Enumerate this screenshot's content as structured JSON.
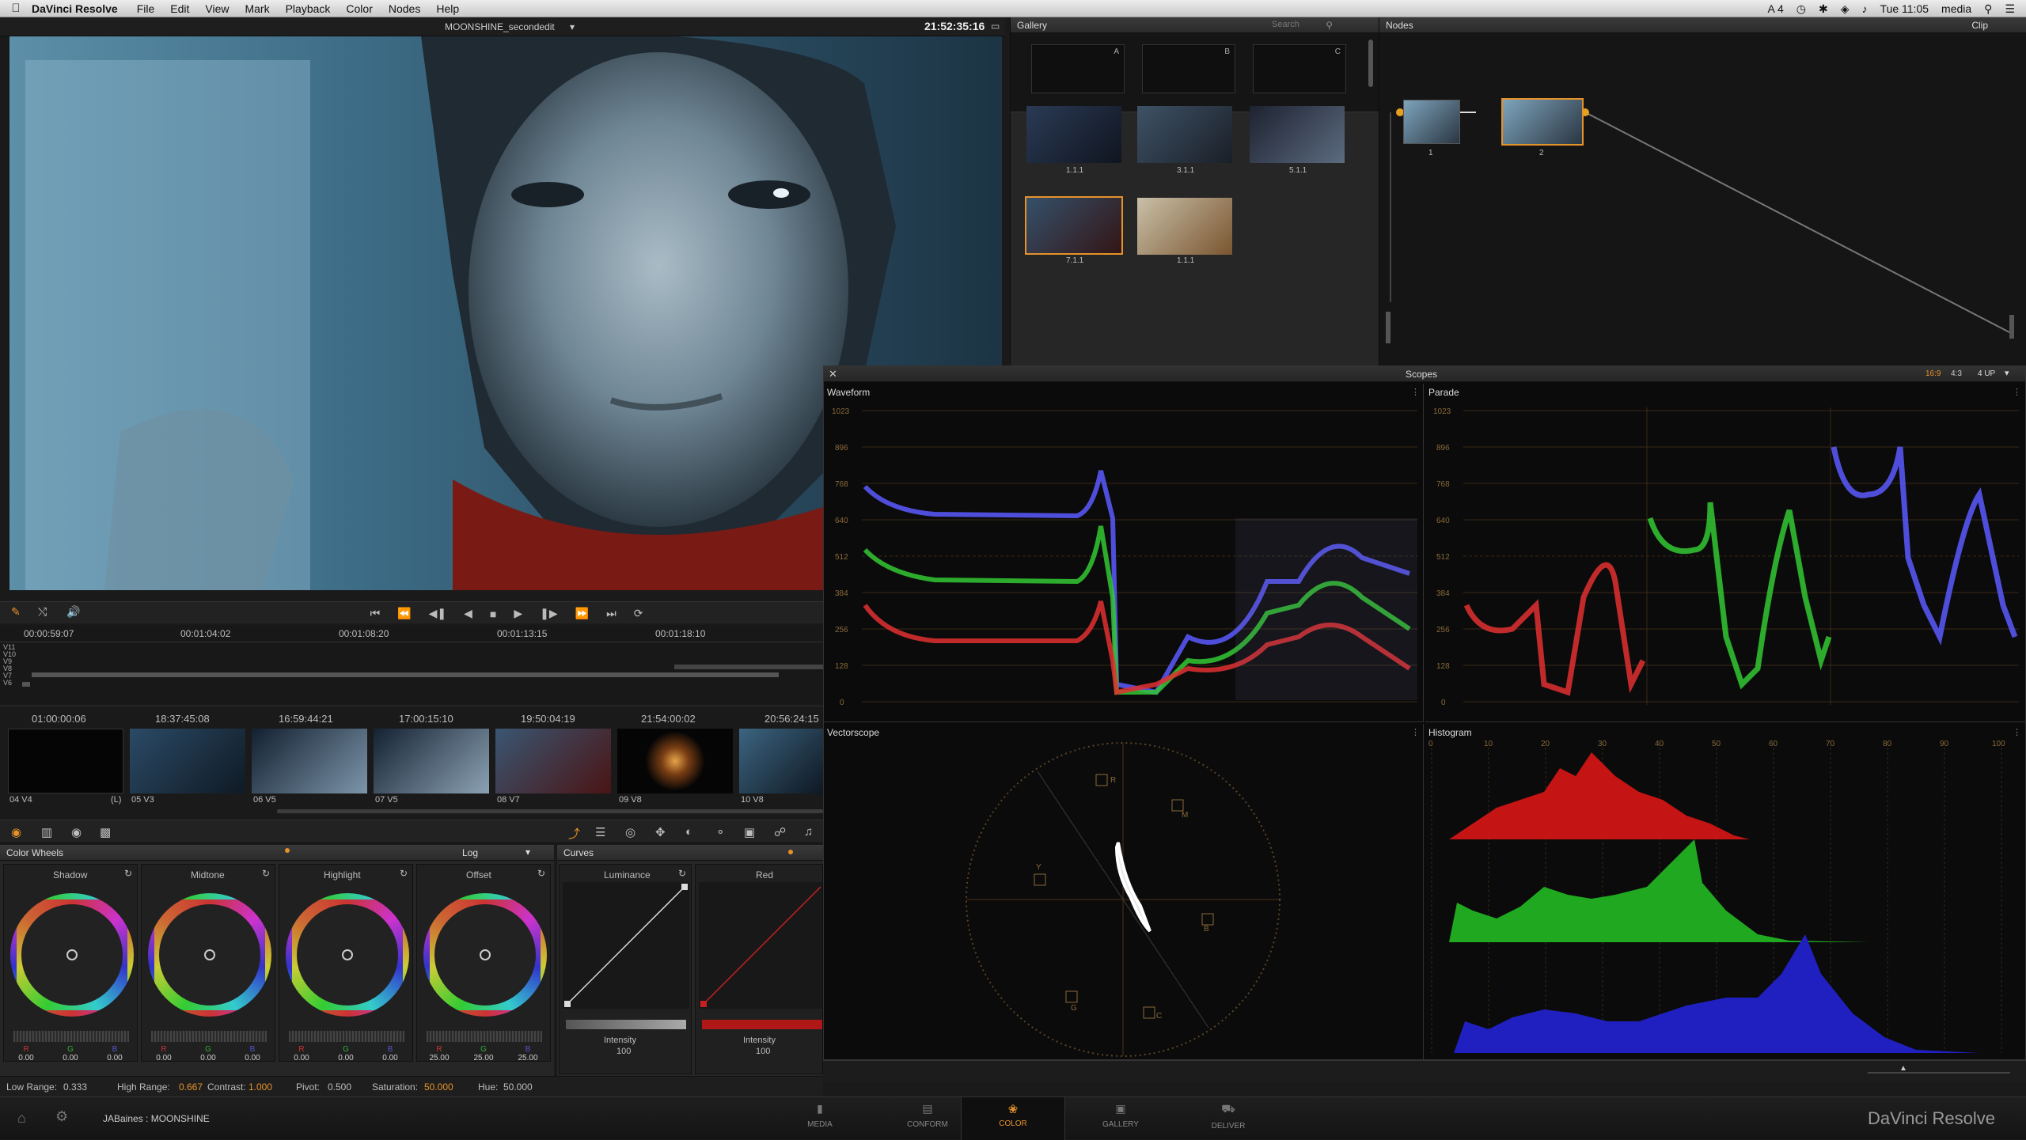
{
  "menubar": {
    "apple": "",
    "app": "DaVinci Resolve",
    "items": [
      "File",
      "Edit",
      "View",
      "Mark",
      "Playback",
      "Color",
      "Nodes",
      "Help"
    ],
    "status": {
      "wifi": "A 4",
      "clock": "Tue 11:05",
      "user": "media"
    }
  },
  "viewer": {
    "clip_title": "MOONSHINE_secondedit",
    "timecode": "21:52:35:16"
  },
  "gallery": {
    "title": "Gallery",
    "search_placeholder": "Search",
    "albums": [
      "A",
      "B",
      "C"
    ],
    "stills": [
      "1.1.1",
      "3.1.1",
      "5.1.1",
      "7.1.1",
      "1.1.1"
    ]
  },
  "nodes": {
    "title": "Nodes",
    "mode": "Clip",
    "items": [
      "1",
      "2"
    ]
  },
  "transport": {
    "icons": [
      "skip-first",
      "step-back-fast",
      "prev-frame",
      "play-reverse",
      "stop",
      "play",
      "next-frame",
      "step-forward-fast",
      "skip-last",
      "loop"
    ]
  },
  "timeline": {
    "ruler": [
      "00:00:59:07",
      "00:01:04:02",
      "00:01:08:20",
      "00:01:13:15",
      "00:01:18:10"
    ],
    "tracks": [
      "V11",
      "V10",
      "V9",
      "V8",
      "V7",
      "V6"
    ]
  },
  "clips": [
    {
      "tc": "01:00:00:06",
      "label": "04 V4",
      "extra": "(L)"
    },
    {
      "tc": "18:37:45:08",
      "label": "05 V3"
    },
    {
      "tc": "16:59:44:21",
      "label": "06 V5"
    },
    {
      "tc": "17:00:15:10",
      "label": "07 V5"
    },
    {
      "tc": "19:50:04:19",
      "label": "08 V7"
    },
    {
      "tc": "21:54:00:02",
      "label": "09 V8"
    },
    {
      "tc": "20:56:24:15",
      "label": "10 V8"
    }
  ],
  "color_wheels": {
    "title": "Color Wheels",
    "mode": "Log",
    "wheels": [
      {
        "name": "Shadow",
        "r": "0.00",
        "g": "0.00",
        "b": "0.00"
      },
      {
        "name": "Midtone",
        "r": "0.00",
        "g": "0.00",
        "b": "0.00"
      },
      {
        "name": "Highlight",
        "r": "0.00",
        "g": "0.00",
        "b": "0.00"
      },
      {
        "name": "Offset",
        "r": "25.00",
        "g": "25.00",
        "b": "25.00"
      }
    ],
    "rgb_labels": [
      "R",
      "G",
      "B"
    ],
    "footer": {
      "low_range_label": "Low Range:",
      "low_range": "0.333",
      "high_range_label": "High Range:",
      "high_range": "0.667",
      "contrast_label": "Contrast:",
      "contrast": "1.000",
      "pivot_label": "Pivot:",
      "pivot": "0.500",
      "saturation_label": "Saturation:",
      "saturation": "50.000",
      "hue_label": "Hue:",
      "hue": "50.000"
    }
  },
  "curves": {
    "title": "Curves",
    "channels": [
      {
        "name": "Luminance",
        "intensity_label": "Intensity",
        "intensity": "100"
      },
      {
        "name": "Red",
        "intensity_label": "Intensity",
        "intensity": "100"
      }
    ]
  },
  "scopes": {
    "title": "Scopes",
    "aspect": [
      "16:9",
      "4:3"
    ],
    "layout": "4 UP",
    "waveform": "Waveform",
    "parade": "Parade",
    "vectorscope": "Vectorscope",
    "histogram": "Histogram",
    "wave_ticks": [
      "1023",
      "896",
      "768",
      "640",
      "512",
      "384",
      "256",
      "128",
      "0"
    ],
    "hist_ticks": [
      "0",
      "10",
      "20",
      "30",
      "40",
      "50",
      "60",
      "70",
      "80",
      "90",
      "100"
    ],
    "vector_targets": [
      "R",
      "M",
      "B",
      "C",
      "G",
      "Y"
    ]
  },
  "project": {
    "name": "JABaines : MOONSHINE"
  },
  "pages": [
    "MEDIA",
    "CONFORM",
    "COLOR",
    "GALLERY",
    "DELIVER"
  ],
  "active_page": "COLOR",
  "brand": "DaVinci Resolve",
  "colors": {
    "accent": "#e6922a",
    "red": "#c82020",
    "green": "#2fb82f",
    "blue": "#3535d8"
  }
}
